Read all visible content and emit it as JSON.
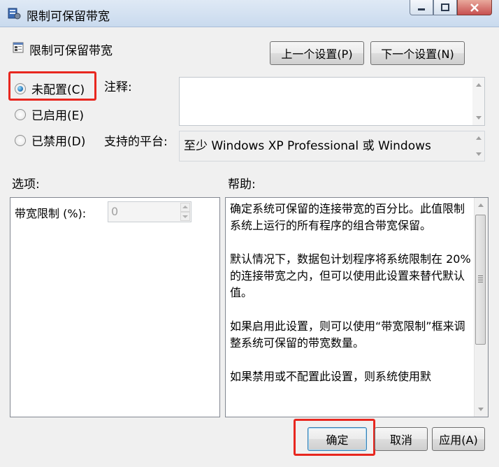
{
  "window": {
    "title": "限制可保留带宽",
    "icon": "policy-icon",
    "buttons": {
      "minimize": "minimize-icon",
      "maximize": "maximize-icon",
      "close": "close-icon"
    }
  },
  "header": {
    "title": "限制可保留带宽",
    "icon": "setting-icon",
    "prev_button": "上一个设置(P)",
    "next_button": "下一个设置(N)"
  },
  "state": {
    "options": [
      {
        "label": "未配置(C)",
        "checked": true
      },
      {
        "label": "已启用(E)",
        "checked": false
      },
      {
        "label": "已禁用(D)",
        "checked": false
      }
    ]
  },
  "comment": {
    "label": "注释:",
    "value": ""
  },
  "platform": {
    "label": "支持的平台:",
    "value": "至少 Windows XP Professional 或 Windows"
  },
  "options_pane": {
    "heading": "选项:",
    "field_label": "带宽限制 (%):",
    "field_value": "0"
  },
  "help_pane": {
    "heading": "帮助:",
    "paragraphs": [
      "确定系统可保留的连接带宽的百分比。此值限制系统上运行的所有程序的组合带宽保留。",
      "默认情况下，数据包计划程序将系统限制在 20% 的连接带宽之内，但可以使用此设置来替代默认值。",
      "如果启用此设置，则可以使用“带宽限制”框来调整系统可保留的带宽数量。",
      "如果禁用或不配置此设置，则系统使用默"
    ]
  },
  "footer": {
    "ok": "确定",
    "cancel": "取消",
    "apply": "应用(A)"
  },
  "colors": {
    "highlight": "#e8271f",
    "radio_fill": "#1d6fb4"
  }
}
